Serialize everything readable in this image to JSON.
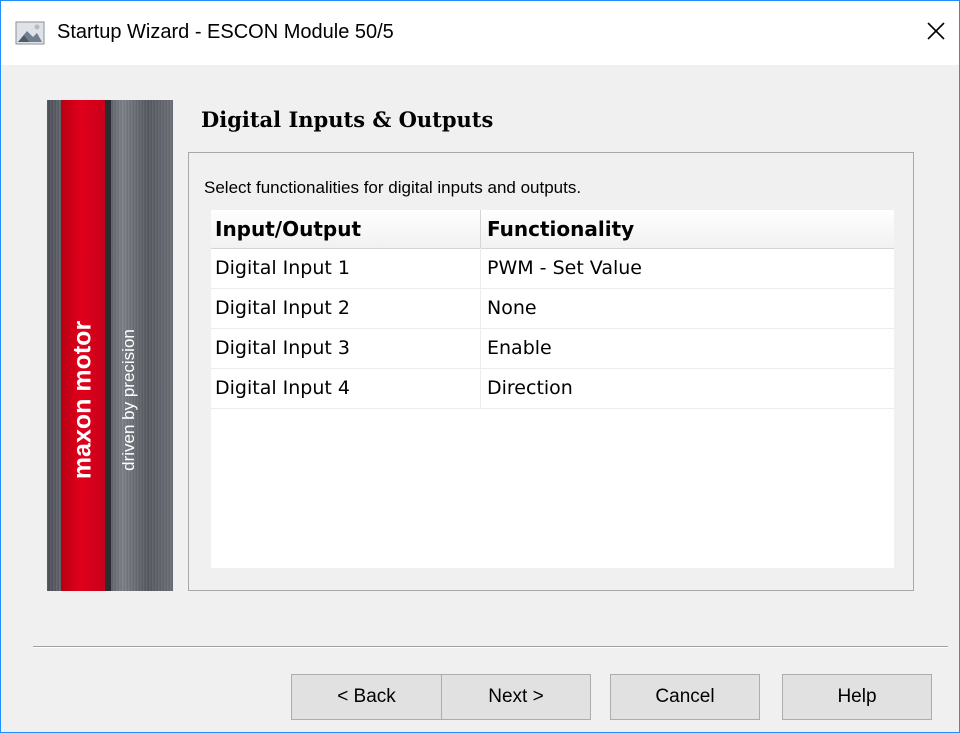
{
  "window": {
    "title": "Startup Wizard - ESCON Module 50/5",
    "app_icon": "wizard-app-icon",
    "close_icon": "close-icon"
  },
  "banner": {
    "brand": "maxon motor",
    "tagline": "driven by precision",
    "colors": {
      "red": "#e0001b",
      "steel": "#5c6068"
    }
  },
  "page": {
    "heading": "Digital Inputs & Outputs",
    "instruction": "Select functionalities for digital inputs and outputs."
  },
  "table": {
    "columns": [
      "Input/Output",
      "Functionality"
    ],
    "rows": [
      {
        "io": "Digital Input 1",
        "function": "PWM - Set Value"
      },
      {
        "io": "Digital Input 2",
        "function": "None"
      },
      {
        "io": "Digital Input 3",
        "function": "Enable"
      },
      {
        "io": "Digital Input 4",
        "function": "Direction"
      }
    ]
  },
  "buttons": {
    "back": "< Back",
    "next": "Next >",
    "cancel": "Cancel",
    "help": "Help"
  }
}
